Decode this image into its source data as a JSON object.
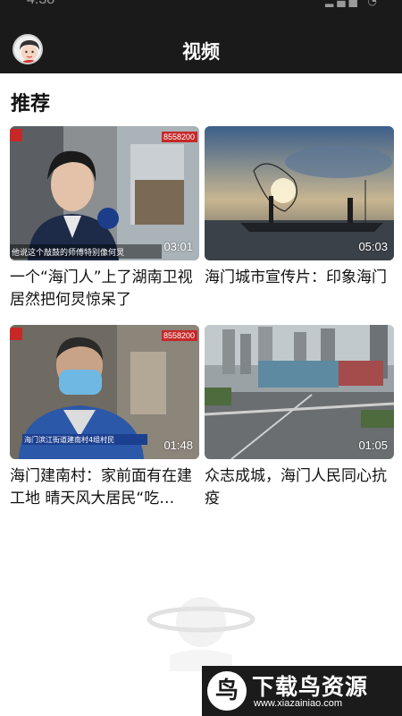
{
  "status_bar": {
    "time": "4:38",
    "icons": "▂▄▆ ◔"
  },
  "header": {
    "title": "视频",
    "avatar_icon": "user-avatar-icon"
  },
  "section": {
    "title": "推荐"
  },
  "videos": [
    {
      "caption": "一个“海门人”上了湖南卫视 居然把何炅惊呆了",
      "duration": "03:01",
      "overlay_text": "他说这个敲鼓的师傅特别像何炅",
      "badge": "8558200"
    },
    {
      "caption": "海门城市宣传片：印象海门",
      "duration": "05:03"
    },
    {
      "caption": "海门建南村：家前面有在建工地 晴天风大居民“吃…",
      "duration": "01:48",
      "overlay_text": "海门滨江街道建南村4组村民",
      "badge": "8558200"
    },
    {
      "caption": "众志成城，海门人民同心抗疫",
      "duration": "01:05"
    }
  ],
  "watermark": {
    "logo": "鸟",
    "title": "下载鸟资源",
    "url": "www.xiazainiao.com"
  },
  "colors": {
    "nav_bg": "#1a1a1a",
    "page_bg": "#ffffff",
    "text": "#111111"
  }
}
